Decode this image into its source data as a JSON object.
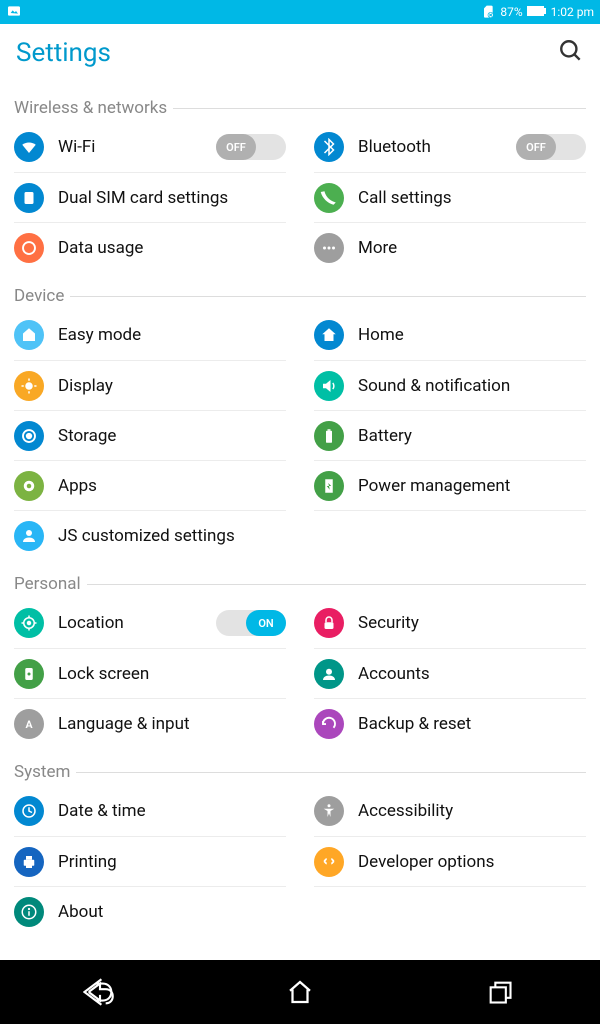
{
  "status": {
    "battery_pct": "87%",
    "time": "1:02 pm"
  },
  "header": {
    "title": "Settings"
  },
  "toggle_labels": {
    "off": "OFF",
    "on": "ON"
  },
  "sections": {
    "wireless": {
      "title": "Wireless & networks",
      "items": {
        "wifi": "Wi-Fi",
        "bluetooth": "Bluetooth",
        "dualsim": "Dual SIM card settings",
        "call": "Call settings",
        "data": "Data usage",
        "more": "More"
      }
    },
    "device": {
      "title": "Device",
      "items": {
        "easy": "Easy mode",
        "home": "Home",
        "display": "Display",
        "sound": "Sound & notification",
        "storage": "Storage",
        "battery": "Battery",
        "apps": "Apps",
        "power": "Power management",
        "custom": "JS customized settings"
      }
    },
    "personal": {
      "title": "Personal",
      "items": {
        "location": "Location",
        "security": "Security",
        "lock": "Lock screen",
        "accounts": "Accounts",
        "language": "Language & input",
        "backup": "Backup & reset"
      }
    },
    "system": {
      "title": "System",
      "items": {
        "datetime": "Date & time",
        "accessibility": "Accessibility",
        "printing": "Printing",
        "developer": "Developer options",
        "about": "About"
      }
    }
  }
}
